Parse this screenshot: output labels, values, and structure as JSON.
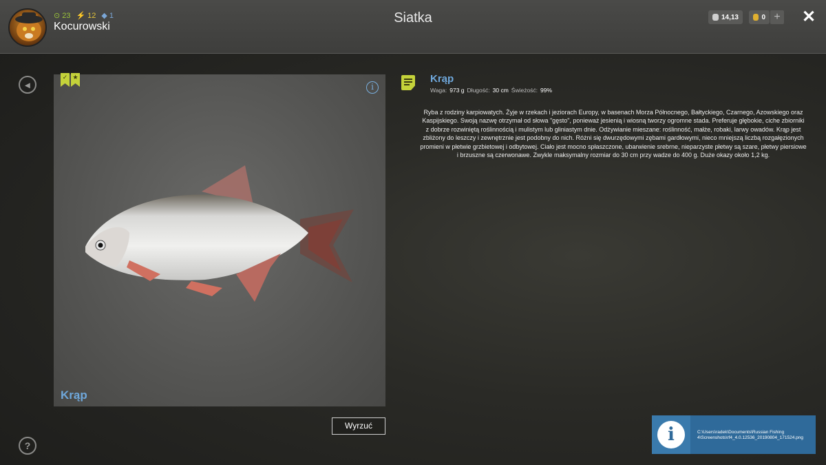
{
  "header": {
    "title": "Siatka",
    "username": "Kocurowski",
    "level": "23",
    "xp_stat": "12",
    "rank_stat": "1",
    "silver": "14,13",
    "gold": "0",
    "plus": "+",
    "close": "✕"
  },
  "icons": {
    "back": "back-icon",
    "help": "question-icon",
    "info": "info-icon",
    "notes": "document-icon"
  },
  "fish_panel": {
    "name": "Krąp",
    "info_glyph": "i",
    "ribbon_check": "✓",
    "ribbon_star": "★"
  },
  "details": {
    "name": "Krąp",
    "weight_label": "Waga:",
    "weight_value": "973 g",
    "length_label": "Długość:",
    "length_value": "30 cm",
    "freshness_label": "Świeżość:",
    "freshness_value": "99%",
    "description": "Ryba z rodziny karpiowatych. Żyje w rzekach i jeziorach Europy, w basenach Morza Północnego, Bałtyckiego, Czarnego, Azowskiego oraz Kaspijskiego. Swoją nazwę otrzymał od słowa \"gęsto\", ponieważ jesienią i wiosną tworzy ogromne stada. Preferuje głębokie, ciche zbiorniki z dobrze rozwiniętą roślinnością i mulistym lub gliniastym dnie. Odżywianie mieszane: roślinność, małże, robaki, larwy owadów. Krąp jest zbliżony do leszczy i zewnętrznie jest podobny do nich. Różni się dwurzędowymi zębami gardłowymi, nieco mniejszą liczbą rozgałęzionych promieni w płetwie grzbietowej i odbytowej. Ciało jest mocno spłaszczone, ubarwienie srebrne, nieparzyste płetwy są szare, płetwy piersiowe i brzuszne są czerwonawe. Zwykle maksymalny rozmiar do 30 cm przy wadze do 400 g. Duże okazy około 1,2 kg."
  },
  "actions": {
    "discard": "Wyrzuć"
  },
  "notification": {
    "glyph": "i",
    "text": "C:\\Users\\radek\\Documents\\Russian Fishing 4\\Screenshots\\rf4_4.0.12536_20190804_171524.png"
  },
  "colors": {
    "accent_blue": "#6fa8dc",
    "accent_yellow_green": "#c4d23a",
    "notification_bg": "#2f6a9a"
  }
}
